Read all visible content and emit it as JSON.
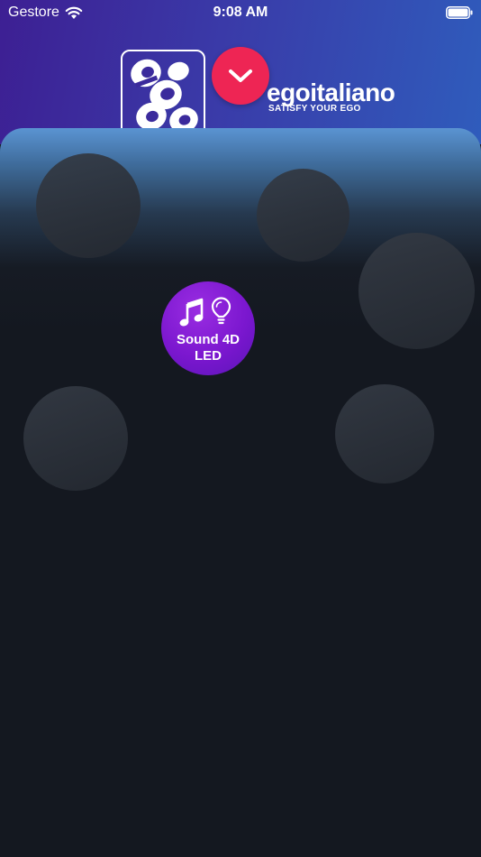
{
  "status_bar": {
    "carrier": "Gestore",
    "time": "9:08 AM"
  },
  "brand": {
    "name": "egoitaliano",
    "tagline": "SATISFY YOUR EGO"
  },
  "collapse_button": {
    "icon": "chevron-down-icon"
  },
  "features": [
    {
      "line1": "Sound 4D",
      "line2": "LED",
      "icons": [
        "music-note-icon",
        "light-bulb-icon"
      ]
    }
  ],
  "colors": {
    "header_start": "#3d1f93",
    "header_end": "#2f5cbc",
    "collapse_button": "#ee2554",
    "feature_button": "#7b17cf",
    "background": "#141820"
  }
}
